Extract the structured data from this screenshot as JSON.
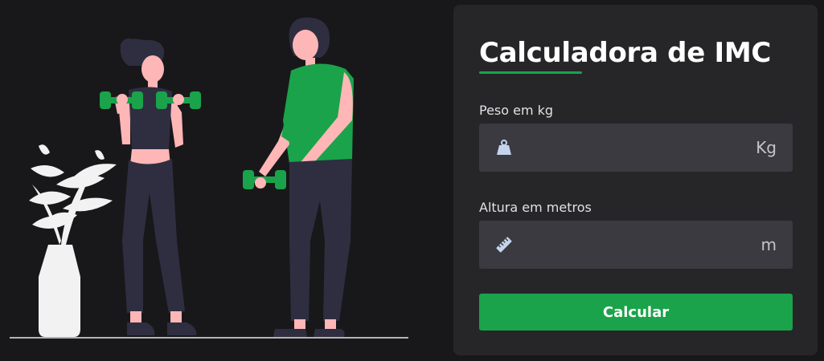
{
  "form": {
    "title": "Calculadora de IMC",
    "weight": {
      "label": "Peso em kg",
      "value": "",
      "placeholder": "",
      "unit": "Kg",
      "icon": "weight-icon"
    },
    "height": {
      "label": "Altura em metros",
      "value": "",
      "placeholder": "",
      "unit": "m",
      "icon": "ruler-icon"
    },
    "submit_label": "Calcular"
  },
  "colors": {
    "background": "#18181a",
    "card": "#262628",
    "input": "#3a3a40",
    "accent": "#1aa34a",
    "text": "#ffffff"
  }
}
